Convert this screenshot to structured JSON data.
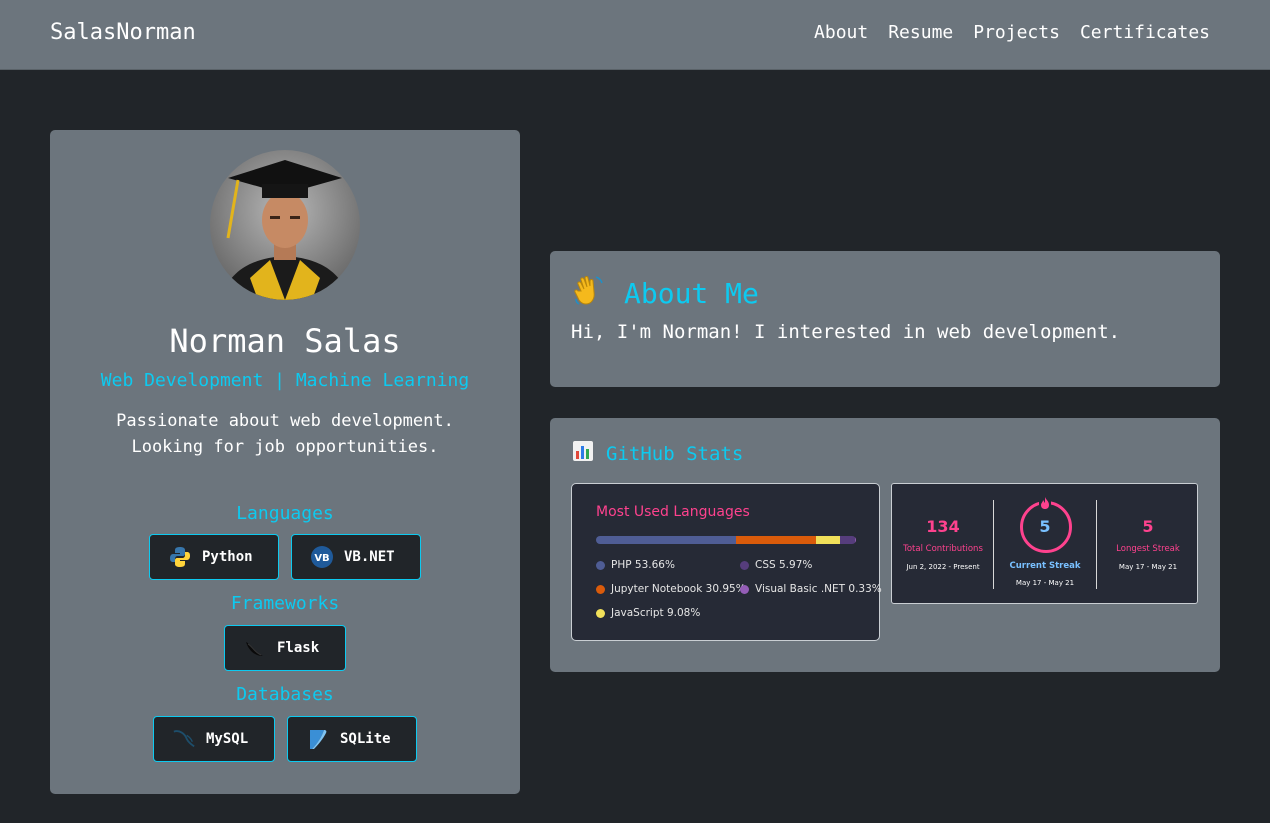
{
  "nav": {
    "brand": "SalasNorman",
    "links": [
      "About",
      "Resume",
      "Projects",
      "Certificates"
    ]
  },
  "profile": {
    "name": "Norman Salas",
    "subtitle": "Web Development | Machine Learning",
    "bio_line1": "Passionate about web development.",
    "bio_line2": "Looking for job opportunities.",
    "languages_heading": "Languages",
    "languages": [
      "Python",
      "VB.NET"
    ],
    "frameworks_heading": "Frameworks",
    "frameworks": [
      "Flask"
    ],
    "databases_heading": "Databases",
    "databases": [
      "MySQL",
      "SQLite"
    ]
  },
  "about": {
    "title": "About Me",
    "text": "Hi, I'm Norman! I interested in web development."
  },
  "github": {
    "title": "GitHub Stats",
    "languages_card": {
      "title": "Most Used Languages",
      "items": [
        {
          "label": "PHP 53.66%",
          "percent": 53.66,
          "color": "#4f5d95"
        },
        {
          "label": "CSS 5.97%",
          "percent": 5.97,
          "color": "#563d7c"
        },
        {
          "label": "Jupyter Notebook 30.95%",
          "percent": 30.95,
          "color": "#da5b0b"
        },
        {
          "label": "Visual Basic .NET 0.33%",
          "percent": 0.33,
          "color": "#945db7"
        },
        {
          "label": "JavaScript 9.08%",
          "percent": 9.08,
          "color": "#f1e05a"
        }
      ]
    },
    "streak_card": {
      "total_value": "134",
      "total_label": "Total Contributions",
      "total_range": "Jun 2, 2022 - Present",
      "current_value": "5",
      "current_label": "Current Streak",
      "current_range": "May 17 - May 21",
      "longest_value": "5",
      "longest_label": "Longest Streak",
      "longest_range": "May 17 - May 21"
    }
  },
  "colors": {
    "accent": "#0dcaf0",
    "card_bg": "#6c757d",
    "page_bg": "#212529",
    "streak_pink": "#fe428e",
    "streak_blue": "#79c0ff"
  }
}
